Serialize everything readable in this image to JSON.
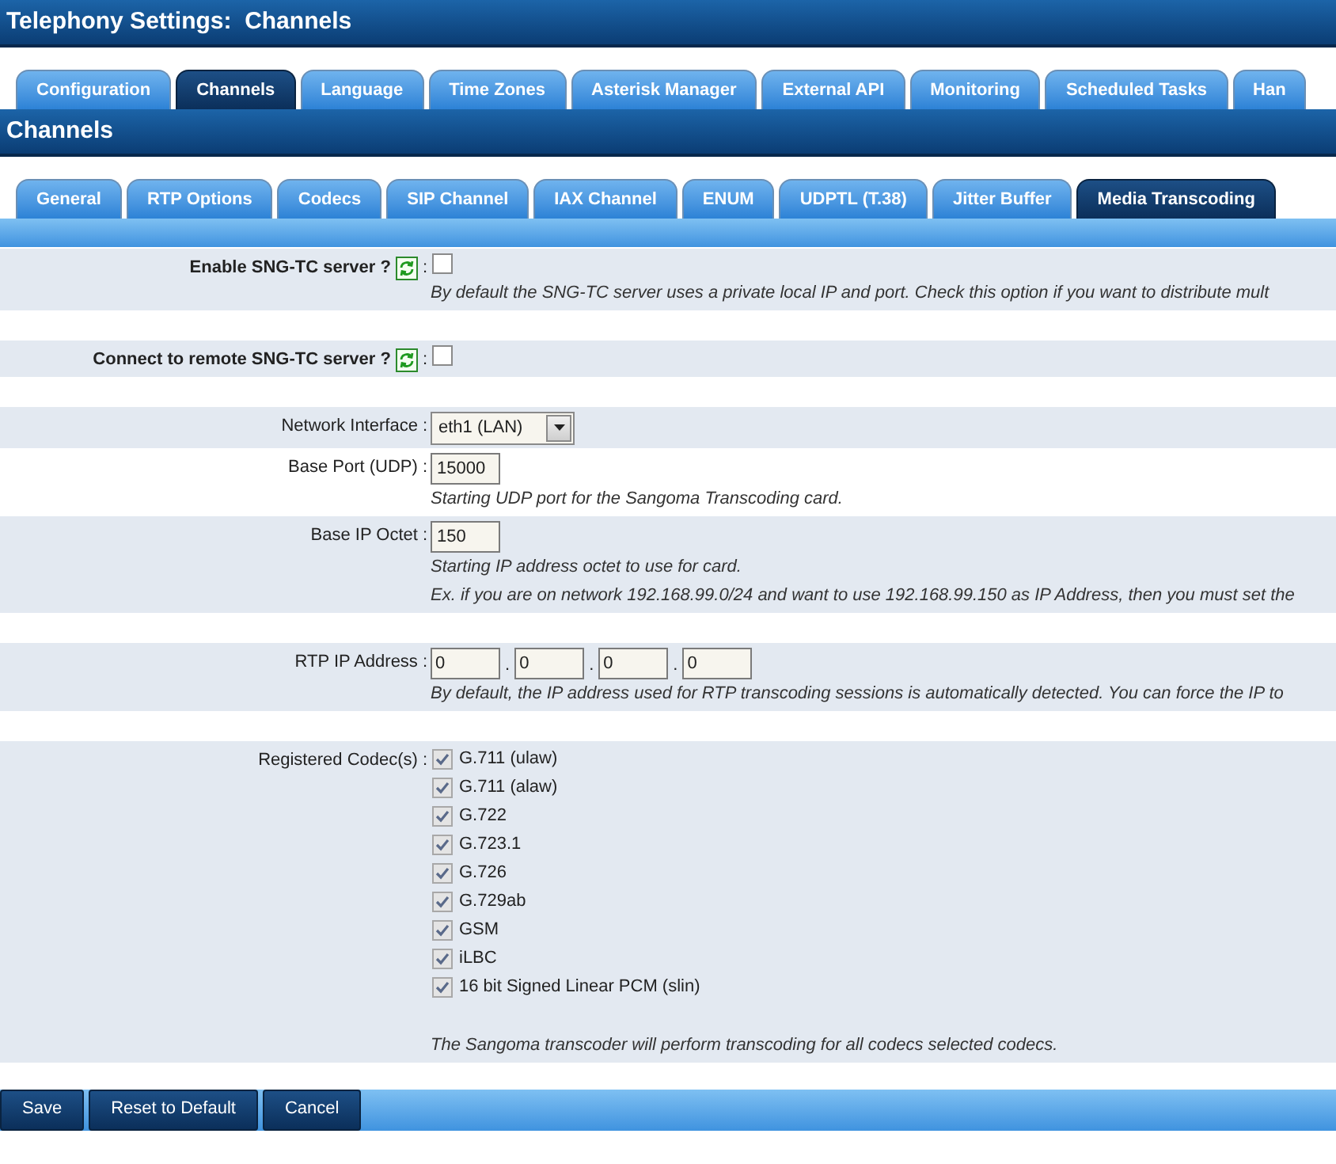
{
  "title": "Telephony Settings:  Channels",
  "main_tabs": [
    {
      "label": "Configuration",
      "selected": false
    },
    {
      "label": "Channels",
      "selected": true
    },
    {
      "label": "Language",
      "selected": false
    },
    {
      "label": "Time Zones",
      "selected": false
    },
    {
      "label": "Asterisk Manager",
      "selected": false
    },
    {
      "label": "External API",
      "selected": false
    },
    {
      "label": "Monitoring",
      "selected": false
    },
    {
      "label": "Scheduled Tasks",
      "selected": false
    },
    {
      "label": "Han",
      "selected": false
    }
  ],
  "section_title": "Channels",
  "sub_tabs": [
    {
      "label": "General",
      "selected": false
    },
    {
      "label": "RTP Options",
      "selected": false
    },
    {
      "label": "Codecs",
      "selected": false
    },
    {
      "label": "SIP Channel",
      "selected": false
    },
    {
      "label": "IAX Channel",
      "selected": false
    },
    {
      "label": "ENUM",
      "selected": false
    },
    {
      "label": "UDPTL (T.38)",
      "selected": false
    },
    {
      "label": "Jitter Buffer",
      "selected": false
    },
    {
      "label": "Media Transcoding",
      "selected": true
    }
  ],
  "groups": [
    [
      {
        "kind": "toggle",
        "label": "Enable SNG-TC server ?",
        "colon": ":",
        "checked": false,
        "help": [
          "By default the SNG-TC server uses a private local IP and port. Check this option if you want to distribute mult"
        ]
      }
    ],
    [
      {
        "kind": "toggle",
        "label": "Connect to remote SNG-TC server ?",
        "colon": ":",
        "checked": false
      }
    ],
    [
      {
        "kind": "select",
        "label": "Network Interface",
        "colon": ":",
        "value": "eth1 (LAN)"
      },
      {
        "kind": "text",
        "label": "Base Port (UDP)",
        "colon": ":",
        "value": "15000",
        "help": [
          "Starting UDP port for the Sangoma Transcoding card."
        ]
      },
      {
        "kind": "text",
        "label": "Base IP Octet",
        "colon": ":",
        "value": "150",
        "help": [
          "Starting IP address octet to use for card.",
          "Ex. if you are on network 192.168.99.0/24 and want to use 192.168.99.150 as IP Address, then you must set the"
        ]
      }
    ],
    [
      {
        "kind": "ip",
        "label": "RTP IP Address",
        "colon": ":",
        "octets": [
          "0",
          "0",
          "0",
          "0"
        ],
        "dot": ".",
        "help": [
          "By default, the IP address used for RTP transcoding sessions is automatically detected. You can force the IP to"
        ]
      }
    ],
    [
      {
        "kind": "codecs",
        "label": "Registered Codec(s)",
        "colon": ":",
        "codecs": [
          {
            "label": "G.711 (ulaw)",
            "checked": true,
            "disabled": true
          },
          {
            "label": "G.711 (alaw)",
            "checked": true,
            "disabled": true
          },
          {
            "label": "G.722",
            "checked": true,
            "disabled": true
          },
          {
            "label": "G.723.1",
            "checked": true,
            "disabled": true
          },
          {
            "label": "G.726",
            "checked": true,
            "disabled": true
          },
          {
            "label": "G.729ab",
            "checked": true,
            "disabled": true
          },
          {
            "label": "GSM",
            "checked": true,
            "disabled": true
          },
          {
            "label": "iLBC",
            "checked": true,
            "disabled": true
          },
          {
            "label": "16 bit Signed Linear PCM (slin)",
            "checked": true,
            "disabled": true
          }
        ],
        "help": [
          "The Sangoma transcoder will perform transcoding for all codecs selected codecs."
        ]
      }
    ]
  ],
  "buttons": [
    "Save",
    "Reset to Default",
    "Cancel"
  ]
}
